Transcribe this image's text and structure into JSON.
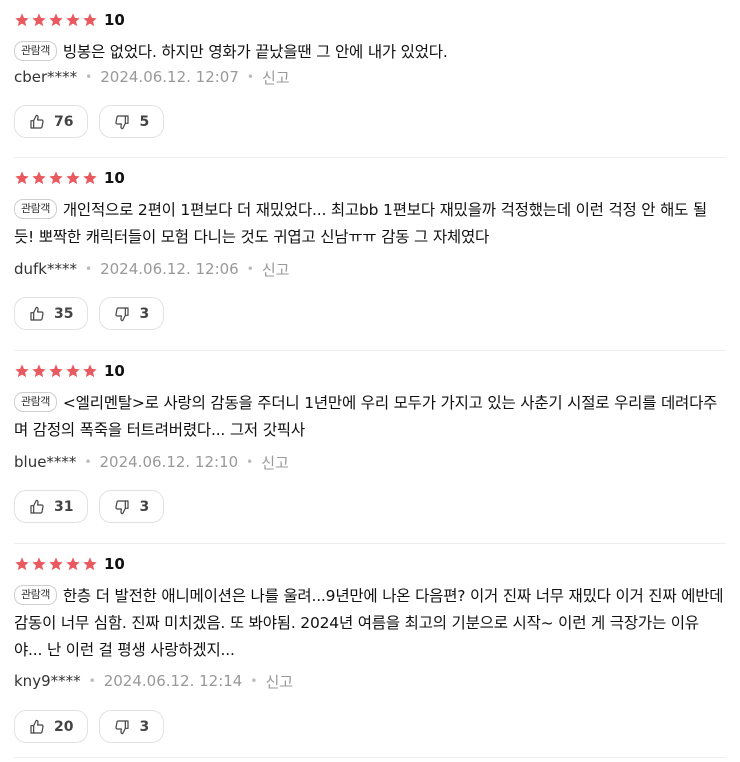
{
  "colors": {
    "star": "#e85960",
    "text": "#111111",
    "muted": "#999999",
    "border": "#e2e2e2"
  },
  "reviews": [
    {
      "stars": 5,
      "score": "10",
      "badge": "관람객",
      "text": "빙봉은 없었다. 하지만 영화가 끝났을땐 그 안에 내가 있었다.",
      "user": "cber****",
      "date": "2024.06.12. 12:07",
      "report": "신고",
      "likes": "76",
      "dislikes": "5"
    },
    {
      "stars": 5,
      "score": "10",
      "badge": "관람객",
      "text": "개인적으로 2편이 1편보다 더 재밌었다... 최고bb 1편보다 재밌을까 걱정했는데 이런 걱정 안 해도 될 듯! 뽀짝한 캐릭터들이 모험 다니는 것도 귀엽고 신남ㅠㅠ 감동 그 자체였다",
      "user": "dufk****",
      "date": "2024.06.12. 12:06",
      "report": "신고",
      "likes": "35",
      "dislikes": "3"
    },
    {
      "stars": 5,
      "score": "10",
      "badge": "관람객",
      "text": "<엘리멘탈>로 사랑의 감동을 주더니 1년만에 우리 모두가 가지고 있는 사춘기 시절로 우리를 데려다주며 감정의 폭죽을 터트려버렸다... 그저 갓픽사",
      "user": "blue****",
      "date": "2024.06.12. 12:10",
      "report": "신고",
      "likes": "31",
      "dislikes": "3"
    },
    {
      "stars": 5,
      "score": "10",
      "badge": "관람객",
      "text": "한층 더 발전한 애니메이션은 나를 울려...9년만에 나온 다음편? 이거 진짜 너무 재밌다 이거 진짜 에반데 감동이 너무 심함. 진짜 미치겠음. 또 봐야됨. 2024년 여름을 최고의 기분으로 시작~ 이런 게 극장가는 이유야... 난 이런 걸 평생 사랑하겠지...",
      "user": "kny9****",
      "date": "2024.06.12. 12:14",
      "report": "신고",
      "likes": "20",
      "dislikes": "3"
    }
  ]
}
